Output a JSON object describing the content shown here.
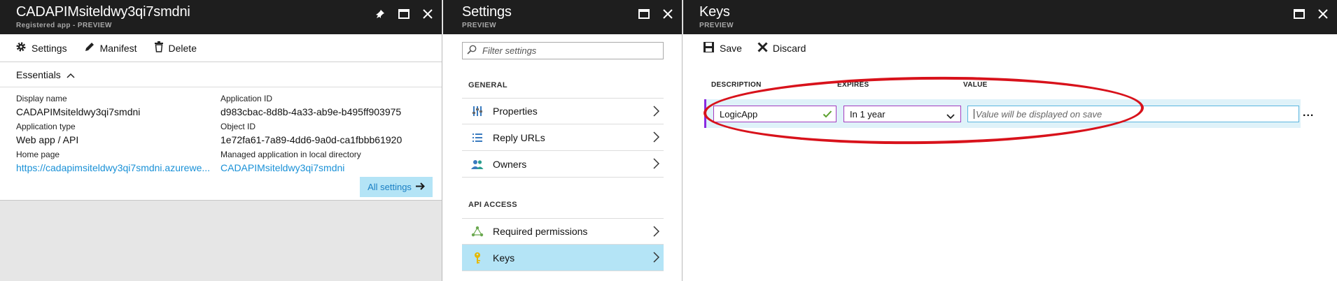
{
  "app_blade": {
    "title": "CADAPIMsiteldwy3qi7smdni",
    "subtitle": "Registered app - PREVIEW",
    "commands": {
      "settings": "Settings",
      "manifest": "Manifest",
      "delete": "Delete"
    },
    "essentials_label": "Essentials",
    "properties": {
      "display_name_label": "Display name",
      "display_name": "CADAPIMsiteldwy3qi7smdni",
      "app_type_label": "Application type",
      "app_type": "Web app / API",
      "home_page_label": "Home page",
      "home_page": "https://cadapimsiteldwy3qi7smdni.azurewe...",
      "app_id_label": "Application ID",
      "app_id": "d983cbac-8d8b-4a33-ab9e-b495ff903975",
      "object_id_label": "Object ID",
      "object_id": "1e72fa61-7a89-4dd6-9a0d-ca1fbbb61920",
      "managed_app_label": "Managed application in local directory",
      "managed_app": "CADAPIMsiteldwy3qi7smdni"
    },
    "all_settings": "All settings"
  },
  "settings_blade": {
    "title": "Settings",
    "subtitle": "PREVIEW",
    "filter_placeholder": "Filter settings",
    "general_label": "GENERAL",
    "general_items": [
      {
        "label": "Properties",
        "icon": "properties-icon"
      },
      {
        "label": "Reply URLs",
        "icon": "list-icon"
      },
      {
        "label": "Owners",
        "icon": "users-icon"
      }
    ],
    "api_label": "API ACCESS",
    "api_items": [
      {
        "label": "Required permissions",
        "icon": "permissions-icon"
      },
      {
        "label": "Keys",
        "icon": "key-icon",
        "selected": true
      }
    ]
  },
  "keys_blade": {
    "title": "Keys",
    "subtitle": "PREVIEW",
    "commands": {
      "save": "Save",
      "discard": "Discard"
    },
    "columns": {
      "description": "DESCRIPTION",
      "expires": "EXPIRES",
      "value": "VALUE"
    },
    "row": {
      "description": "LogicApp",
      "expires": "In 1 year",
      "value_placeholder": "Value will be displayed on save",
      "more": "..."
    }
  },
  "colors": {
    "accent": "#1a91d7",
    "selected": "#b4e4f6",
    "header": "#1e1e1e",
    "highlight_ellipse": "#d8121b",
    "valid_check": "#5aa02c"
  }
}
